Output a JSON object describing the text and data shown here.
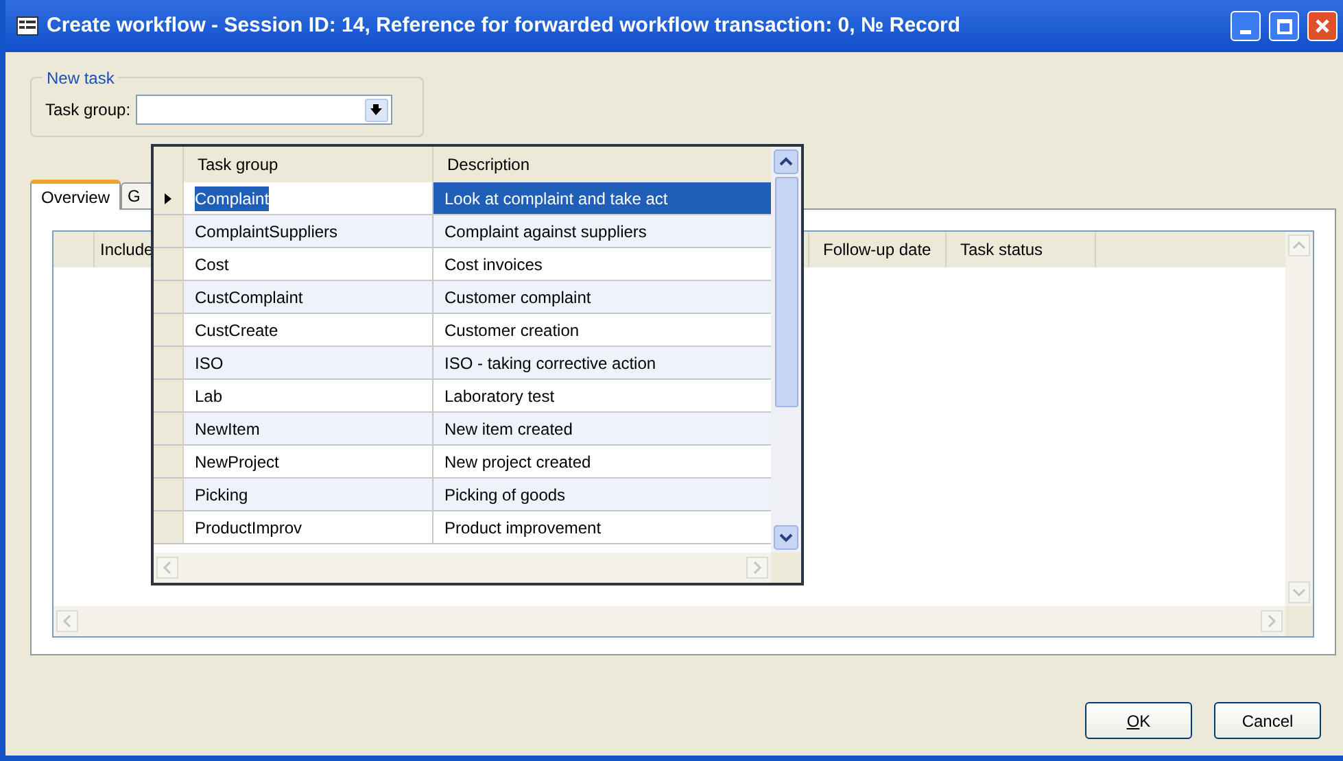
{
  "window": {
    "title": "Create workflow - Session ID: 14, Reference for forwarded workflow transaction: 0, № Record"
  },
  "new_task": {
    "legend": "New task",
    "task_group_label": "Task group:"
  },
  "tabs": [
    {
      "label": "Overview",
      "selected": true
    },
    {
      "label": "G",
      "selected": false
    }
  ],
  "grid": {
    "columns": [
      "Include",
      "Follow-up date",
      "Task status"
    ]
  },
  "lookup": {
    "columns": [
      "Task group",
      "Description"
    ],
    "rows": [
      {
        "task_group": "Complaint",
        "description": "Look at complaint and take act",
        "selected": true
      },
      {
        "task_group": "ComplaintSuppliers",
        "description": "Complaint against suppliers",
        "selected": false
      },
      {
        "task_group": "Cost",
        "description": "Cost invoices",
        "selected": false
      },
      {
        "task_group": "CustComplaint",
        "description": "Customer complaint",
        "selected": false
      },
      {
        "task_group": "CustCreate",
        "description": "Customer creation",
        "selected": false
      },
      {
        "task_group": "ISO",
        "description": "ISO - taking corrective action",
        "selected": false
      },
      {
        "task_group": "Lab",
        "description": "Laboratory test",
        "selected": false
      },
      {
        "task_group": "NewItem",
        "description": "New item created",
        "selected": false
      },
      {
        "task_group": "NewProject",
        "description": "New project created",
        "selected": false
      },
      {
        "task_group": "Picking",
        "description": "Picking of goods",
        "selected": false
      },
      {
        "task_group": "ProductImprov",
        "description": "Product improvement",
        "selected": false
      }
    ]
  },
  "buttons": [
    "OK",
    "Cancel"
  ]
}
